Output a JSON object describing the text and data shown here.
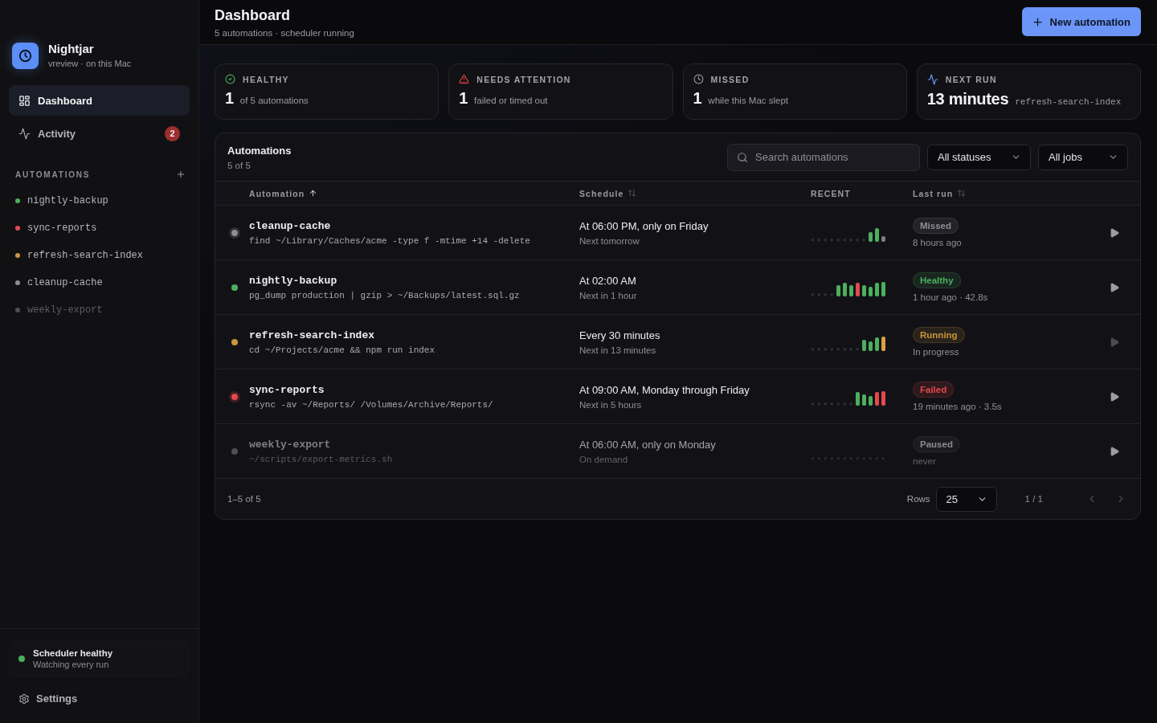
{
  "sidebar": {
    "brand": {
      "name": "Nightjar",
      "subtitle": "vreview · on this Mac"
    },
    "nav": [
      {
        "kind": "dashboard",
        "label": "Dashboard",
        "selected": true
      },
      {
        "kind": "activity",
        "label": "Activity",
        "selected": false,
        "badge": "2"
      }
    ],
    "section_title": "AUTOMATIONS",
    "automations": [
      {
        "name": "nightly-backup",
        "color": "#4caf5f",
        "paused": false,
        "selected": false
      },
      {
        "name": "sync-reports",
        "color": "#e5484d",
        "paused": false,
        "selected": false
      },
      {
        "name": "refresh-search-index",
        "color": "#c9963a",
        "paused": false,
        "selected": false
      },
      {
        "name": "cleanup-cache",
        "color": "#8e8e95",
        "paused": false,
        "selected": false
      },
      {
        "name": "weekly-export",
        "color": "#4f4f56",
        "paused": true,
        "selected": false
      }
    ],
    "scheduler": {
      "color": "#4caf5f",
      "title": "Scheduler healthy",
      "detail": "Watching every run"
    },
    "settings_label": "Settings"
  },
  "header": {
    "title": "Dashboard",
    "subtitle": "5 automations · scheduler running",
    "action": "New automation"
  },
  "stats": [
    {
      "kind": "healthy",
      "label": "HEALTHY",
      "value": "1",
      "caption": "of 5 automations"
    },
    {
      "kind": "attention",
      "label": "NEEDS ATTENTION",
      "value": "1",
      "caption": "failed or timed out"
    },
    {
      "kind": "missed",
      "label": "MISSED",
      "value": "1",
      "caption": "while this Mac slept"
    },
    {
      "kind": "next_run",
      "label": "NEXT RUN",
      "value": "13 minutes",
      "caption": "refresh-search-index"
    }
  ],
  "panel": {
    "title": "Automations",
    "count": "5 of 5",
    "search": {
      "placeholder": "Search automations"
    },
    "filters": [
      {
        "value": "All statuses"
      },
      {
        "value": "All jobs"
      }
    ],
    "columns": [
      {
        "label": "Automation",
        "sortable": true,
        "sorted": true
      },
      {
        "label": "Schedule",
        "sortable": true,
        "sorted": false
      },
      {
        "label": "RECENT",
        "sortable": false
      },
      {
        "label": "Last run",
        "sortable": true,
        "sorted": false
      }
    ],
    "rows": [
      {
        "name": "cleanup-cache",
        "command": "find ~/Library/Caches/acme -type f -mtime +14 -delete",
        "schedule": "At 06:00 PM, only on Friday",
        "next": "Next tomorrow",
        "recent": [
          {
            "kind": "bar",
            "color": "#4caf5f"
          },
          {
            "kind": "bar",
            "color": "#4caf5f"
          },
          {
            "kind": "stub",
            "color": "#7d7d84"
          }
        ],
        "color": "#8e8e95",
        "paused": false,
        "attention": true,
        "badge": "Missed",
        "last_run": "8 hours ago",
        "run_disabled": false
      },
      {
        "name": "nightly-backup",
        "command": "pg_dump production | gzip > ~/Backups/latest.sql.gz",
        "schedule": "At 02:00 AM",
        "next": "Next in 1 hour",
        "recent": [
          {
            "kind": "bar",
            "color": "#4caf5f"
          },
          {
            "kind": "bar",
            "color": "#4caf5f"
          },
          {
            "kind": "bar",
            "color": "#4caf5f"
          },
          {
            "kind": "bar",
            "color": "#e5484d"
          },
          {
            "kind": "bar",
            "color": "#4caf5f"
          },
          {
            "kind": "bar",
            "color": "#4caf5f"
          },
          {
            "kind": "bar",
            "color": "#4caf5f"
          },
          {
            "kind": "bar",
            "color": "#4caf5f"
          }
        ],
        "color": "#4caf5f",
        "paused": false,
        "attention": false,
        "badge": "Healthy",
        "last_run": "1 hour ago · 42.8s",
        "run_disabled": false
      },
      {
        "name": "refresh-search-index",
        "command": "cd ~/Projects/acme && npm run index",
        "schedule": "Every 30 minutes",
        "next": "Next in 13 minutes",
        "recent": [
          {
            "kind": "bar",
            "color": "#4caf5f"
          },
          {
            "kind": "bar",
            "color": "#4caf5f"
          },
          {
            "kind": "bar",
            "color": "#4caf5f"
          },
          {
            "kind": "bar",
            "color": "#d9a23f"
          }
        ],
        "color": "#c9963a",
        "paused": false,
        "attention": false,
        "badge": "Running",
        "last_run": "In progress",
        "run_disabled": true
      },
      {
        "name": "sync-reports",
        "command": "rsync -av ~/Reports/ /Volumes/Archive/Reports/",
        "schedule": "At 09:00 AM, Monday through Friday",
        "next": "Next in 5 hours",
        "recent": [
          {
            "kind": "bar",
            "color": "#4caf5f"
          },
          {
            "kind": "bar",
            "color": "#4caf5f"
          },
          {
            "kind": "bar",
            "color": "#4caf5f"
          },
          {
            "kind": "bar",
            "color": "#e5484d"
          },
          {
            "kind": "bar",
            "color": "#e5484d"
          }
        ],
        "color": "#e5484d",
        "paused": false,
        "attention": true,
        "badge": "Failed",
        "last_run": "19 minutes ago · 3.5s",
        "run_disabled": false
      },
      {
        "name": "weekly-export",
        "command": "~/scripts/export-metrics.sh",
        "schedule": "At 06:00 AM, only on Monday",
        "next": "On demand",
        "color": "#4f4f56",
        "paused": true,
        "attention": false,
        "badge": "Paused",
        "last_run": "never",
        "run_disabled": false
      }
    ],
    "footer": {
      "range": "1–5 of 5",
      "rows_label": "Rows",
      "rows_value": "25",
      "page": "1 / 1",
      "prev_disabled": true,
      "next_disabled": true
    }
  }
}
